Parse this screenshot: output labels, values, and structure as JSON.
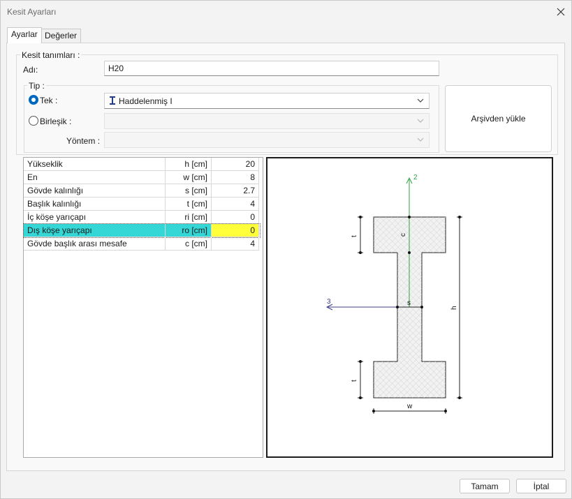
{
  "window": {
    "title": "Kesit Ayarları"
  },
  "tabs": [
    {
      "label": "Ayarlar"
    },
    {
      "label": "Değerler"
    }
  ],
  "section_def": {
    "group_title": "Kesit tanımları :",
    "name_label": "Adı:",
    "name_value": "H20"
  },
  "type_group": {
    "title": "Tip :",
    "single_label": "Tek :",
    "single_value": "Haddelenmiş I",
    "composite_label": "Birleşik :",
    "method_label": "Yöntem :"
  },
  "archive_button": "Arşivden yükle",
  "properties": {
    "rows": [
      {
        "name": "Yükseklik",
        "unit": "h [cm]",
        "value": "20"
      },
      {
        "name": "En",
        "unit": "w [cm]",
        "value": "8"
      },
      {
        "name": "Gövde kalınlığı",
        "unit": "s [cm]",
        "value": "2.7"
      },
      {
        "name": "Başlık kalınlığı",
        "unit": "t [cm]",
        "value": "4"
      },
      {
        "name": "İç köşe yarıçapı",
        "unit": "ri [cm]",
        "value": "0"
      },
      {
        "name": "Dış köşe yarıçapı",
        "unit": "ro [cm]",
        "value": "0"
      },
      {
        "name": "Gövde başlık arası mesafe",
        "unit": "c [cm]",
        "value": "4"
      }
    ],
    "selected_index": 5
  },
  "drawing": {
    "axis_2": "2",
    "axis_3": "3",
    "dim_h": "h",
    "dim_w": "w",
    "dim_t_top": "t",
    "dim_t_bottom": "t",
    "dim_c": "c",
    "dim_s": "s",
    "axis_2_color": "#2ea043",
    "axis_3_color": "#3c3c8c"
  },
  "footer": {
    "ok": "Tamam",
    "cancel": "İptal"
  }
}
